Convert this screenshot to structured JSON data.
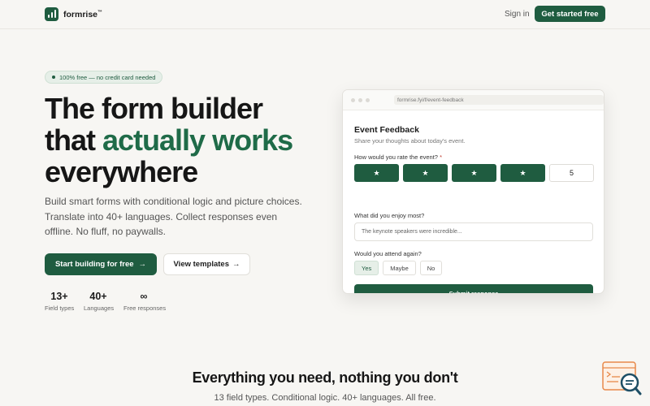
{
  "nav": {
    "brand": "formrise",
    "brand_mark": "™",
    "signin": "Sign in",
    "cta": "Get started free"
  },
  "hero": {
    "badge": "100% free — no credit card needed",
    "headline_line1": "The form builder",
    "headline_line2_a": "that ",
    "headline_line2_accent": "actually works",
    "headline_line3": "everywhere",
    "subtitle": "Build smart forms with conditional logic and picture choices. Translate into 40+ languages. Collect responses even offline. No fluff, no paywalls.",
    "primary_cta": "Start building for free",
    "primary_arrow": "→",
    "secondary_cta": "View templates",
    "secondary_arrow": "→",
    "stats": [
      {
        "num": "13+",
        "label": "Field types"
      },
      {
        "num": "40+",
        "label": "Languages"
      },
      {
        "num": "∞",
        "label": "Free responses"
      }
    ]
  },
  "preview": {
    "url": "formrise.fyi/f/event-feedback",
    "title": "Event Feedback",
    "description": "Share your thoughts about today's event.",
    "q1": "How would you rate the event?",
    "required_mark": "*",
    "rating_star": "★",
    "rating_value": "5",
    "rating_filled": 4,
    "q2": "What did you enjoy most?",
    "q2_value": "The keynote speakers were incredible...",
    "q3": "Would you attend again?",
    "options": [
      "Yes",
      "Maybe",
      "No"
    ],
    "selected_option": "Yes",
    "submit": "Submit response"
  },
  "features": {
    "title": "Everything you need, nothing you don't",
    "subtitle": "13 field types. Conditional logic. 40+ languages. All free."
  },
  "colors": {
    "accent": "#1f5c40",
    "accent_text": "#1f6b48",
    "background": "#f7f6f3"
  },
  "icons": {
    "logo": "bar-chart-icon",
    "widget": "code-search-icon"
  }
}
